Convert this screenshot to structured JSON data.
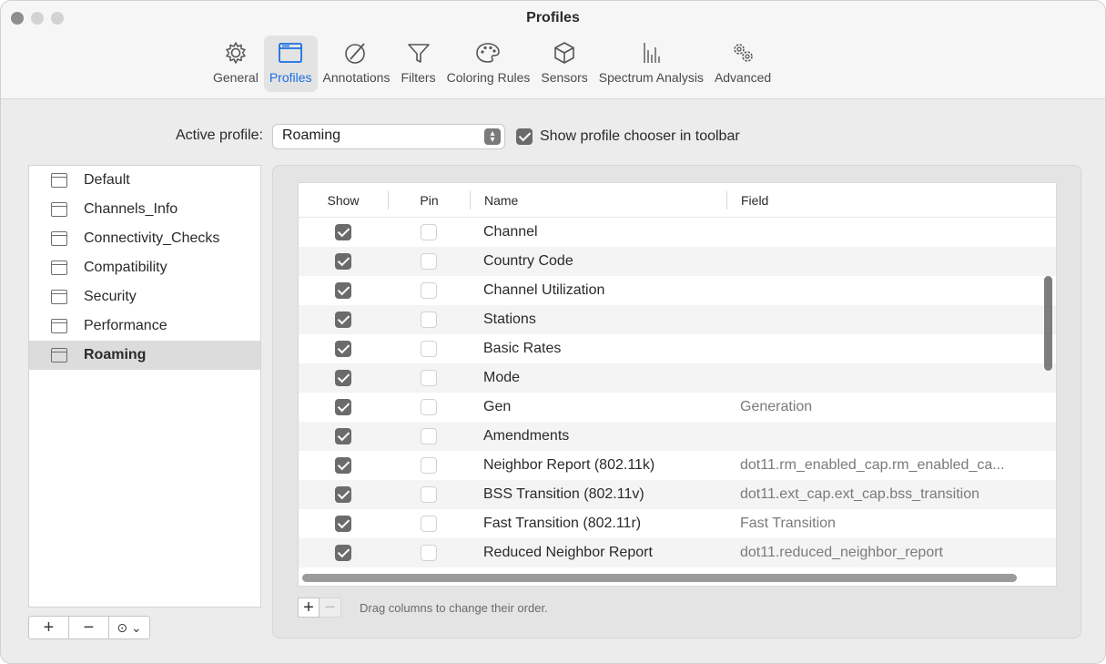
{
  "window": {
    "title": "Profiles"
  },
  "tabs": [
    {
      "label": "General",
      "icon": "gear-icon",
      "active": false
    },
    {
      "label": "Profiles",
      "icon": "window-icon",
      "active": true
    },
    {
      "label": "Annotations",
      "icon": "pen-circle-icon",
      "active": false
    },
    {
      "label": "Filters",
      "icon": "funnel-icon",
      "active": false
    },
    {
      "label": "Coloring Rules",
      "icon": "palette-icon",
      "active": false
    },
    {
      "label": "Sensors",
      "icon": "cube-icon",
      "active": false
    },
    {
      "label": "Spectrum Analysis",
      "icon": "bars-icon",
      "active": false
    },
    {
      "label": "Advanced",
      "icon": "gears-icon",
      "active": false
    }
  ],
  "active_profile": {
    "label": "Active profile:",
    "value": "Roaming",
    "chooser_label": "Show profile chooser in toolbar",
    "chooser_checked": true
  },
  "profiles": [
    {
      "name": "Default",
      "selected": false
    },
    {
      "name": "Channels_Info",
      "selected": false
    },
    {
      "name": "Connectivity_Checks",
      "selected": false
    },
    {
      "name": "Compatibility",
      "selected": false
    },
    {
      "name": "Security",
      "selected": false
    },
    {
      "name": "Performance",
      "selected": false
    },
    {
      "name": "Roaming",
      "selected": true
    }
  ],
  "profile_buttons": {
    "add": "+",
    "remove": "−",
    "more": "⊙ ⌄"
  },
  "table": {
    "headers": {
      "show": "Show",
      "pin": "Pin",
      "name": "Name",
      "field": "Field"
    },
    "rows": [
      {
        "show": true,
        "pin": false,
        "name": "Channel",
        "field": ""
      },
      {
        "show": true,
        "pin": false,
        "name": "Country Code",
        "field": ""
      },
      {
        "show": true,
        "pin": false,
        "name": "Channel Utilization",
        "field": ""
      },
      {
        "show": true,
        "pin": false,
        "name": "Stations",
        "field": ""
      },
      {
        "show": true,
        "pin": false,
        "name": "Basic Rates",
        "field": ""
      },
      {
        "show": true,
        "pin": false,
        "name": "Mode",
        "field": ""
      },
      {
        "show": true,
        "pin": false,
        "name": "Gen",
        "field": "Generation"
      },
      {
        "show": true,
        "pin": false,
        "name": "Amendments",
        "field": ""
      },
      {
        "show": true,
        "pin": false,
        "name": "Neighbor Report (802.11k)",
        "field": "dot11.rm_enabled_cap.rm_enabled_ca..."
      },
      {
        "show": true,
        "pin": false,
        "name": "BSS Transition (802.11v)",
        "field": "dot11.ext_cap.ext_cap.bss_transition"
      },
      {
        "show": true,
        "pin": false,
        "name": "Fast Transition (802.11r)",
        "field": "Fast Transition"
      },
      {
        "show": true,
        "pin": false,
        "name": "Reduced Neighbor Report",
        "field": "dot11.reduced_neighbor_report"
      }
    ]
  },
  "panel_buttons": {
    "add": "+",
    "remove": "−",
    "hint": "Drag columns to change their order."
  }
}
